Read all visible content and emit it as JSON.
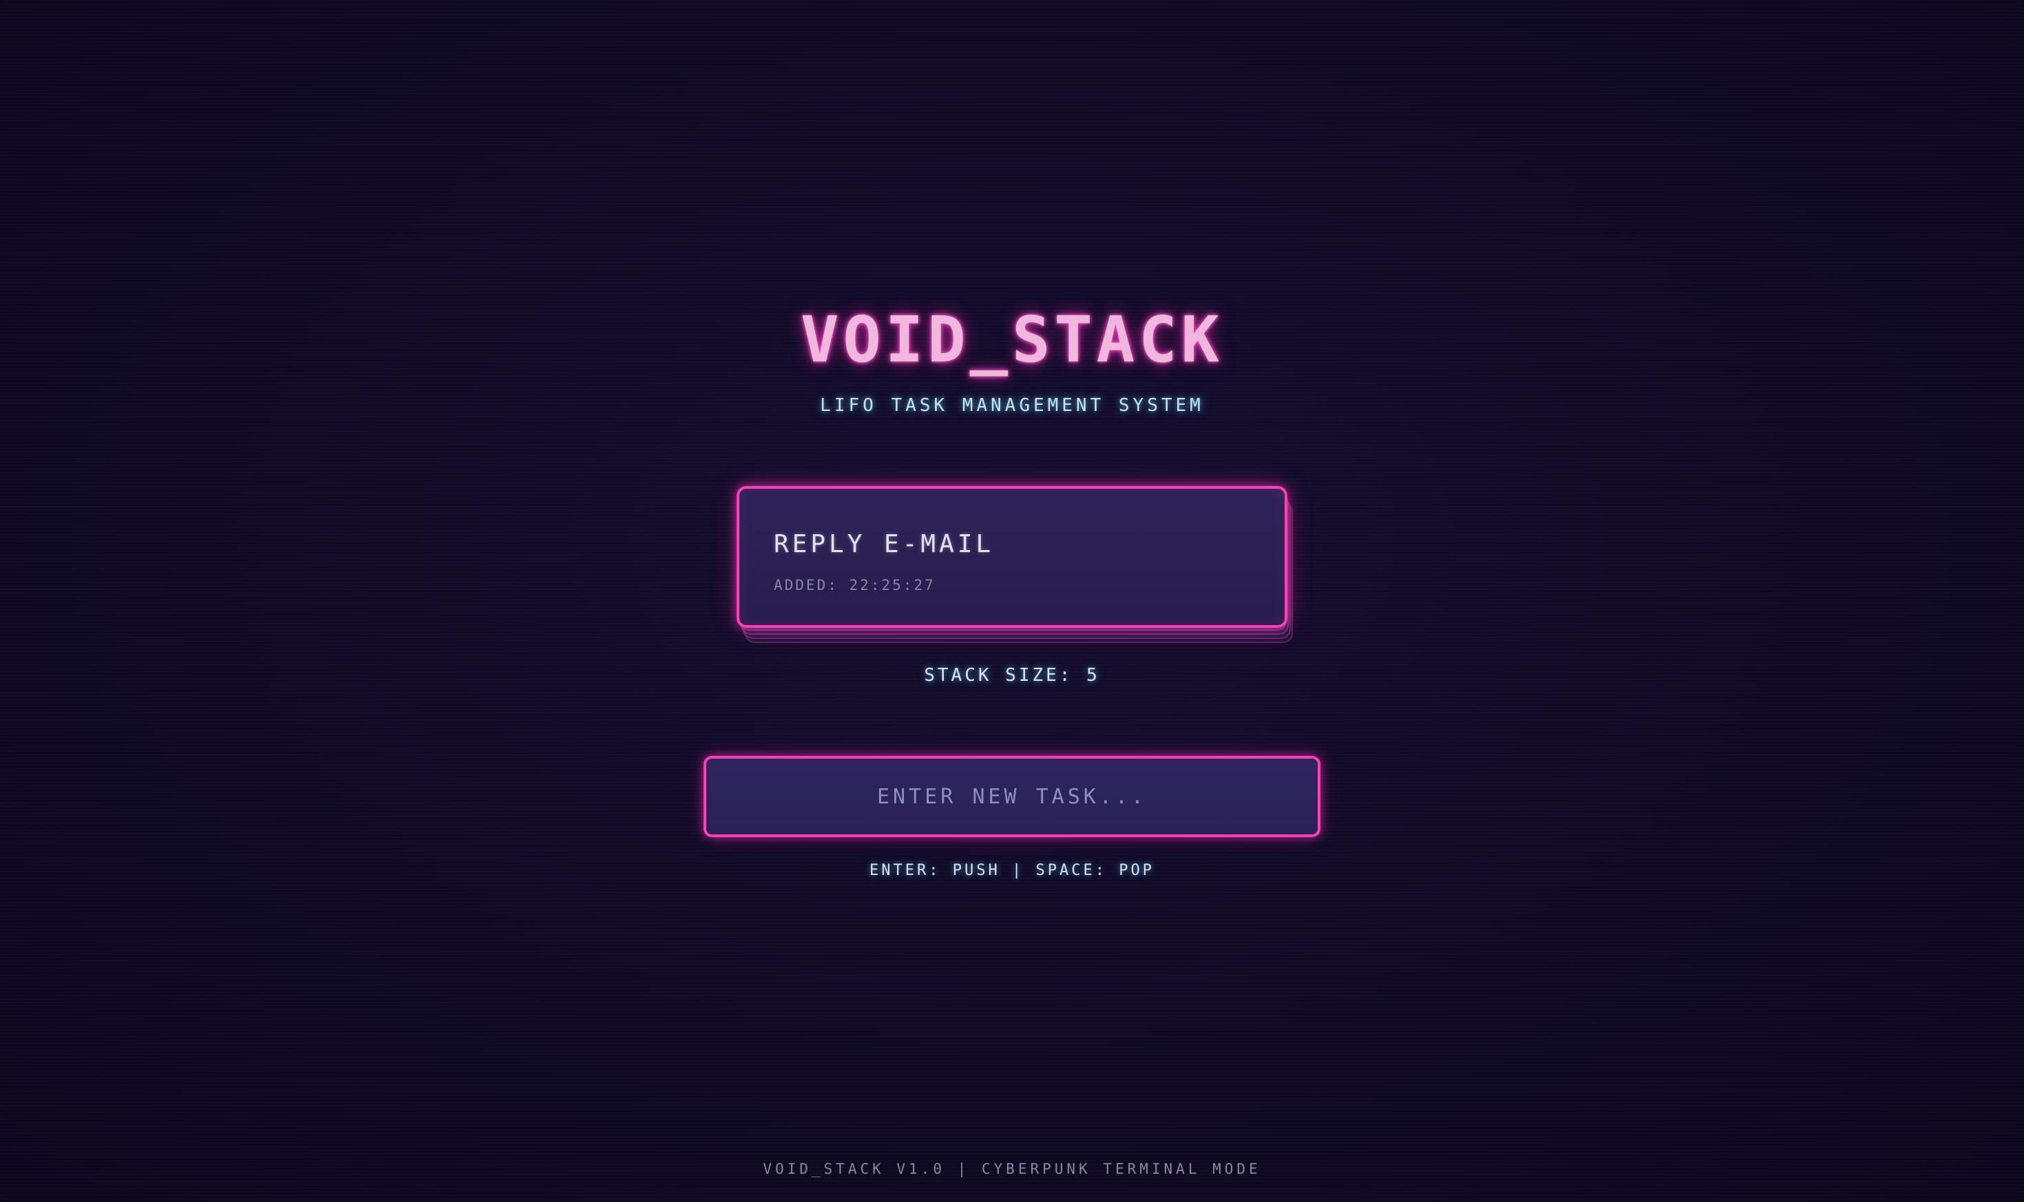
{
  "app": {
    "title": "VOID_STACK",
    "subtitle": "LIFO TASK MANAGEMENT SYSTEM"
  },
  "stack": {
    "top_task": {
      "title": "REPLY E-MAIL",
      "added": "ADDED: 22:25:27"
    },
    "size_label": "STACK SIZE: 5",
    "size": 5
  },
  "input": {
    "value": "",
    "placeholder": "ENTER NEW TASK..."
  },
  "hint": "ENTER: PUSH | SPACE: POP",
  "footer": "VOID_STACK V1.0 | CYBERPUNK TERMINAL MODE",
  "colors": {
    "accent": "#ff3fb4",
    "background": "#0d0820",
    "card": "#2d2358",
    "cyan_text": "#bfe6f2",
    "title_text": "#f0b8dc"
  }
}
